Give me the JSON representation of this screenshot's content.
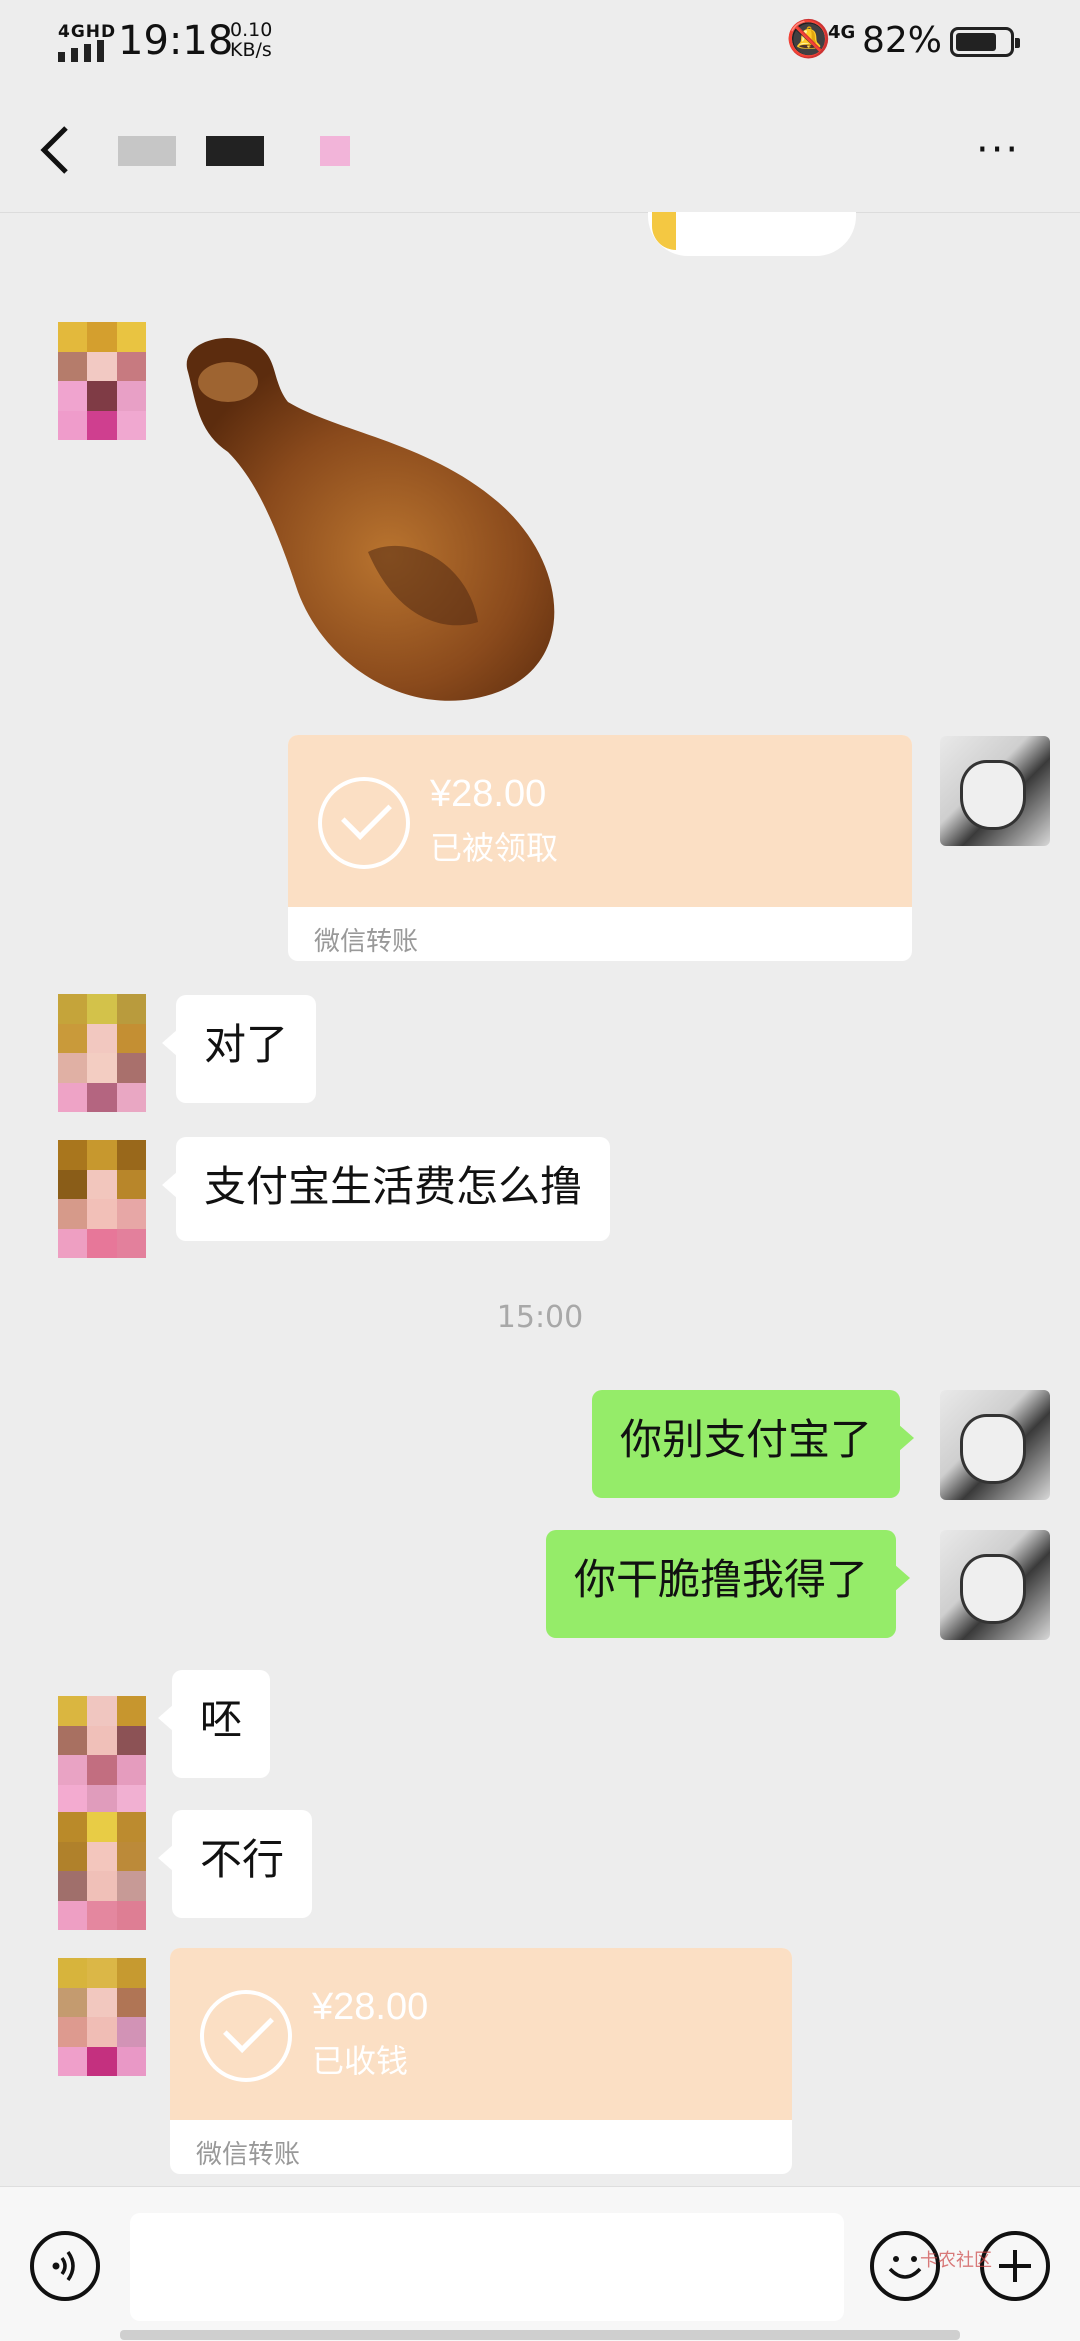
{
  "status_bar": {
    "network": "4GHD",
    "time": "19:18",
    "speed": "0.10",
    "speed_unit": "KB/s",
    "network_right": "4G",
    "battery": "82%",
    "battery_level": 0.82
  },
  "header": {
    "more_label": "···"
  },
  "messages": [
    {
      "from": "other",
      "type": "sticker",
      "icon": "drumstick-sticker"
    },
    {
      "from": "me",
      "type": "transfer",
      "amount": "¥28.00",
      "status": "已被领取",
      "label": "微信转账"
    },
    {
      "from": "other",
      "type": "text",
      "text": "对了"
    },
    {
      "from": "other",
      "type": "text",
      "text": "支付宝生活费怎么撸"
    },
    {
      "from": "system",
      "type": "time",
      "text": "15:00"
    },
    {
      "from": "me",
      "type": "text",
      "text": "你别支付宝了"
    },
    {
      "from": "me",
      "type": "text",
      "text": "你干脆撸我得了"
    },
    {
      "from": "other",
      "type": "text",
      "text": "呸"
    },
    {
      "from": "other",
      "type": "text",
      "text": "不行"
    },
    {
      "from": "other",
      "type": "transfer",
      "amount": "¥28.00",
      "status": "已收钱",
      "label": "微信转账"
    }
  ],
  "watermark": "卡农社区",
  "colors": {
    "bg": "#ededed",
    "green_bubble": "#95ec69",
    "transfer": "#fbdfc4"
  }
}
